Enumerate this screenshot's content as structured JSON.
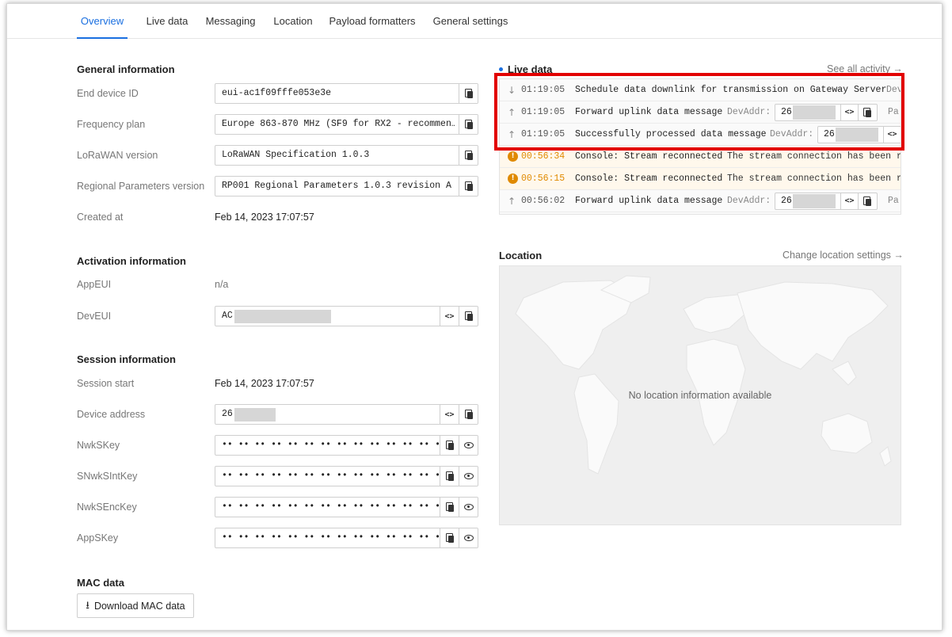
{
  "tabs": [
    "Overview",
    "Live data",
    "Messaging",
    "Location",
    "Payload formatters",
    "General settings"
  ],
  "general": {
    "title": "General information",
    "end_device_id_label": "End device ID",
    "end_device_id": "eui-ac1f09fffe053e3e",
    "frequency_plan_label": "Frequency plan",
    "frequency_plan": "Europe 863-870 MHz (SF9 for RX2 - recommen…",
    "lorawan_version_label": "LoRaWAN version",
    "lorawan_version": "LoRaWAN Specification 1.0.3",
    "regional_params_label": "Regional Parameters version",
    "regional_params": "RP001 Regional Parameters 1.0.3 revision A",
    "created_at_label": "Created at",
    "created_at": "Feb 14, 2023 17:07:57"
  },
  "activation": {
    "title": "Activation information",
    "appeui_label": "AppEUI",
    "appeui": "n/a",
    "deveui_label": "DevEUI",
    "deveui": "AC"
  },
  "session": {
    "title": "Session information",
    "session_start_label": "Session start",
    "session_start": "Feb 14, 2023 17:07:57",
    "device_address_label": "Device address",
    "device_address": "26",
    "nwkskey_label": "NwkSKey",
    "snwksintkey_label": "SNwkSIntKey",
    "nwksenckey_label": "NwkSEncKey",
    "appskey_label": "AppSKey",
    "masked": "•• •• •• •• •• •• •• •• •• •• •• •• •• •• •• ••"
  },
  "mac": {
    "title": "MAC data",
    "download_label": "Download MAC data"
  },
  "live": {
    "title": "Live data",
    "see_all": "See all activity →",
    "events": [
      {
        "dir": "down",
        "time": "01:19:05",
        "desc": "Schedule data downlink for transmission on Gateway Server",
        "extra": "Dev"
      },
      {
        "dir": "up",
        "time": "01:19:05",
        "desc": "Forward uplink data message",
        "extra": "DevAddr:",
        "box": "26",
        "tail": "Pa"
      },
      {
        "dir": "up",
        "time": "01:19:05",
        "desc": "Successfully processed data message",
        "extra": "DevAddr:",
        "box": "26"
      },
      {
        "dir": "warn",
        "time": "00:56:34",
        "desc": "Console: Stream reconnected",
        "extra": "The stream connection has been re"
      },
      {
        "dir": "warn",
        "time": "00:56:15",
        "desc": "Console: Stream reconnected",
        "extra": "The stream connection has been re"
      },
      {
        "dir": "up",
        "time": "00:56:02",
        "desc": "Forward uplink data message",
        "extra": "DevAddr:",
        "box": "26",
        "tail": "Pa"
      }
    ]
  },
  "location": {
    "title": "Location",
    "change": "Change location settings →",
    "empty": "No location information available"
  }
}
